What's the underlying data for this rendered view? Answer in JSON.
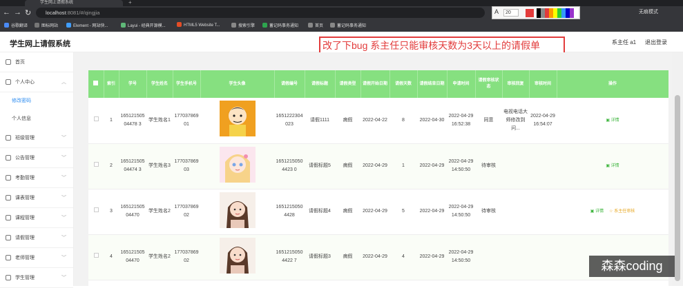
{
  "browser": {
    "tab_title": "学生网上请假系统",
    "new_tab": "+",
    "url_host": "localhost",
    "url_path": ":8081/#/qingjia",
    "bookmarks": [
      "谷歌翻译",
      "图标网站",
      "Element - 网站快...",
      "Layui - 经典开源模...",
      "HTML5 Website T...",
      "搜索引擎",
      "蓄记码事务通知",
      "首页",
      "蓄记码事务通知"
    ],
    "profile_label": "无痕模式",
    "toolbar_font_size": "20"
  },
  "header": {
    "title": "学生网上请假系统",
    "user": "系主任 a1",
    "logout": "退出登录"
  },
  "annotation": "改了下bug  系主任只能审核天数为3天以上的请假单",
  "sidebar": {
    "items": [
      {
        "label": "首页"
      },
      {
        "label": "个人中心"
      },
      {
        "label": "修改密码"
      },
      {
        "label": "个人信息"
      },
      {
        "label": "班级管理"
      },
      {
        "label": "公告管理"
      },
      {
        "label": "考勤管理"
      },
      {
        "label": "课表管理"
      },
      {
        "label": "课程管理"
      },
      {
        "label": "请假管理"
      },
      {
        "label": "老师管理"
      },
      {
        "label": "学生管理"
      }
    ]
  },
  "table": {
    "columns": [
      "索引",
      "学号",
      "学生姓名",
      "学生手机号",
      "学生头像",
      "请假编号",
      "请假标题",
      "请假类型",
      "请假开始日期",
      "请假天数",
      "请假结束日期",
      "申请时间",
      "请假审核状态",
      "审核回复",
      "审核时间",
      "操作"
    ],
    "rows": [
      {
        "index": "1",
        "sid": "16512150504478 3",
        "name": "学生姓名1",
        "phone": "17703786901",
        "no": "1651222304023",
        "title": "请假1111",
        "type": "病假",
        "start": "2022-04-22",
        "days": "8",
        "end": "2022-04-30",
        "apply": "2022-04-29 16:52:38",
        "status": "同意",
        "reply": "电视电话大师修改到问...",
        "rtime": "2022-04-29 16:54:07",
        "ops": [
          "详情"
        ],
        "avatar": "boy"
      },
      {
        "index": "2",
        "sid": "16512150504474 3",
        "name": "学生姓名3",
        "phone": "17703786903",
        "no": "16512150504423 0",
        "title": "请假标题5",
        "type": "病假",
        "start": "2022-04-29",
        "days": "1",
        "end": "2022-04-29",
        "apply": "2022-04-29 14:50:50",
        "status": "待审核",
        "reply": "",
        "rtime": "",
        "ops": [
          "详情"
        ],
        "avatar": "girl"
      },
      {
        "index": "3",
        "sid": "16512150504470",
        "name": "学生姓名2",
        "phone": "17703786902",
        "no": "16512150504428",
        "title": "请假标题4",
        "type": "病假",
        "start": "2022-04-29",
        "days": "5",
        "end": "2022-04-29",
        "apply": "2022-04-29 14:50:50",
        "status": "待审核",
        "reply": "",
        "rtime": "",
        "ops": [
          "详情",
          "系主任审核"
        ],
        "avatar": "woman"
      },
      {
        "index": "4",
        "sid": "16512150504470",
        "name": "学生姓名2",
        "phone": "17703786902",
        "no": "16512150504422 7",
        "title": "请假标题3",
        "type": "病假",
        "start": "2022-04-29",
        "days": "4",
        "end": "2022-04-29",
        "apply": "2022-04-29 14:50:50",
        "status": "",
        "reply": "",
        "rtime": "",
        "ops": [],
        "avatar": "woman"
      }
    ]
  },
  "watermark": "森森coding",
  "colors": {
    "header_green": "#86e080",
    "note_red": "#e23b3b",
    "link_green": "#3db53d",
    "link_orange": "#e7a824"
  }
}
